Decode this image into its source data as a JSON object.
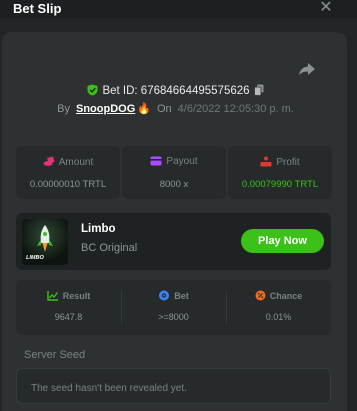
{
  "header": {
    "title": "Bet Slip"
  },
  "bet": {
    "id_text": "Bet ID: 67684664495575626",
    "by_label": "By",
    "user": "SnoopDOG",
    "on_label": "On",
    "date": "4/6/2022 12:05:30 p. m."
  },
  "stats": [
    {
      "label": "Amount",
      "value": "0.00000010 TRTL",
      "icon": "coins-icon",
      "color": "#e0337a"
    },
    {
      "label": "Payout",
      "value": "8000 x",
      "icon": "wallet-icon",
      "color": "#a64dff"
    },
    {
      "label": "Profit",
      "value": "0.00079990 TRTL",
      "icon": "podium-icon",
      "color": "#e2362e"
    }
  ],
  "game": {
    "thumb_text": "LIMBO",
    "name": "Limbo",
    "subtitle": "BC Original",
    "play_label": "Play Now"
  },
  "result": [
    {
      "label": "Result",
      "value": "9647.8",
      "icon": "chart-icon",
      "color": "#3bc117"
    },
    {
      "label": "Bet",
      "value": ">=8000",
      "icon": "target-icon",
      "color": "#3b82f6"
    },
    {
      "label": "Chance",
      "value": "0.01%",
      "icon": "percent-icon",
      "color": "#f26b1d"
    }
  ],
  "seed": {
    "label": "Server Seed",
    "text": "The seed hasn't been revealed yet."
  },
  "colors": {
    "accent": "#3bc117",
    "background": "#232626",
    "panel": "#2d3132"
  }
}
